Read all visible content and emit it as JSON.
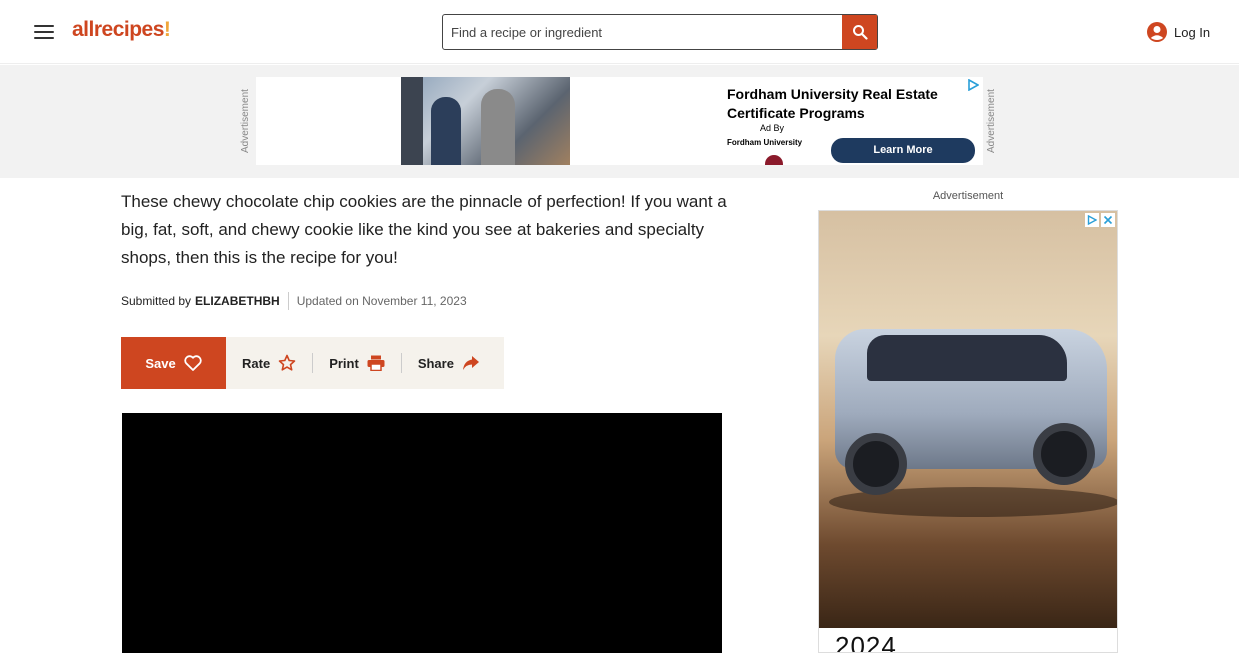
{
  "header": {
    "logo_main": "allrecipes",
    "logo_bang": "!",
    "search_placeholder": "Find a recipe or ingredient",
    "login_label": "Log In"
  },
  "top_ad": {
    "vertical_label": "Advertisement",
    "title": "Fordham University Real Estate Certificate Programs",
    "ad_by": "Ad By",
    "org": "Fordham University",
    "cta": "Learn More"
  },
  "article": {
    "intro": "These chewy chocolate chip cookies are the pinnacle of perfection! If you want a big, fat, soft, and chewy cookie like the kind you see at bakeries and specialty shops, then this is the recipe for you!",
    "submitted_by_label": "Submitted by",
    "author": "ELIZABETHBH",
    "updated": "Updated on November 11, 2023"
  },
  "actions": {
    "save": "Save",
    "rate": "Rate",
    "print": "Print",
    "share": "Share"
  },
  "rail_ad": {
    "label": "Advertisement",
    "year_text": "2024"
  },
  "colors": {
    "brand": "#ce4620",
    "action_bar_bg": "#f5f2ec",
    "ad_strip_bg": "#f2f2f2"
  }
}
